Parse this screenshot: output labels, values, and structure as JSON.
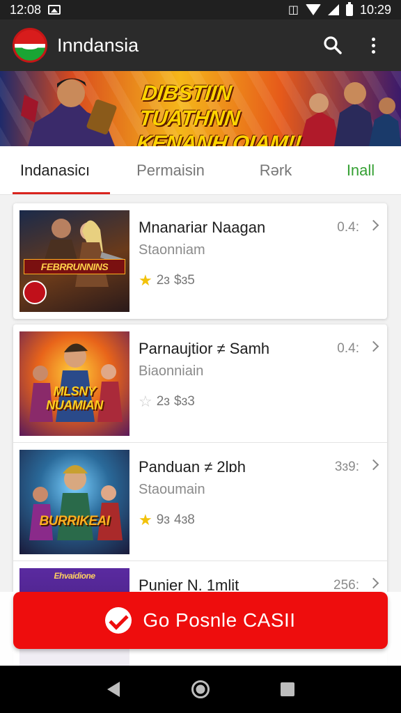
{
  "status_bar": {
    "time_left": "12:08",
    "time_right": "10:29",
    "vibrate_glyph": "▕▢▏"
  },
  "app_bar": {
    "title": "Inndansia",
    "logo_icon": "app-logo-icon",
    "search_icon": "search-icon",
    "more_icon": "more-vert-icon"
  },
  "banner": {
    "headline": "DIBSTIIN TUATHNN KENANH QIAM!!"
  },
  "tabs": [
    {
      "label": "Indanasicı",
      "active": true
    },
    {
      "label": "Permaisin",
      "active": false
    },
    {
      "label": "Rərk",
      "active": false
    },
    {
      "label": "Inall",
      "active": false,
      "color": "#35a033"
    }
  ],
  "items": [
    {
      "title": "Mnanariar Naagan",
      "subtitle": "Staonniam",
      "rating": "2ɜ",
      "price": "$ɜ5",
      "meta": "0.4:",
      "star": "filled",
      "thumb_caption": "FEBRRUNNINS"
    },
    {
      "title": "Parnaujtior ≠ Samh",
      "subtitle": "Biaonniain",
      "rating": "2ɜ",
      "price": "$ɜ3",
      "meta": "0.4:",
      "star": "empty",
      "thumb_caption": "MLSNY NUAMIAN"
    },
    {
      "title": "Panduan ≠ 2lɒh",
      "subtitle": "Staoumain",
      "rating": "9ɜ",
      "price": "4ɜ8",
      "meta": "3ɜ9:",
      "star": "filled",
      "thumb_caption": "BURRIKEAI"
    },
    {
      "title": "Punier N. 1mlit",
      "subtitle": "",
      "rating": "",
      "price": "",
      "meta": "256:",
      "star": "none",
      "thumb_caption": "Ehvaidione"
    }
  ],
  "cta": {
    "label": "Go Posnle CASII",
    "icon": "check-circle-icon",
    "color": "#ee0d0d"
  },
  "nav": {
    "back_icon": "back-icon",
    "home_icon": "home-icon",
    "recents_icon": "recents-icon"
  }
}
